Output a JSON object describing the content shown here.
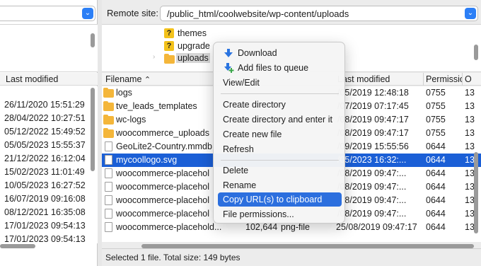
{
  "left": {
    "column_last_modified": "Last modified",
    "dates": [
      "26/11/2020 15:51:29",
      "28/04/2022 10:27:51",
      "05/12/2022 15:49:52",
      "05/05/2023 15:55:37",
      "21/12/2022 16:12:04",
      "15/02/2023 11:01:49",
      "10/05/2023 16:27:52",
      "16/07/2019 09:16:08",
      "08/12/2021 16:35:08",
      "17/01/2023 09:54:13",
      "17/01/2023 09:54:13"
    ]
  },
  "remote": {
    "label": "Remote site:",
    "path": "/public_html/coolwebsite/wp-content/uploads",
    "tree": [
      {
        "label": "themes",
        "icon": "question-folder-icon"
      },
      {
        "label": "upgrade",
        "icon": "question-folder-icon"
      },
      {
        "label": "uploads",
        "icon": "folder-icon"
      }
    ]
  },
  "columns": {
    "filename": "Filename",
    "last_modified": "Last modified",
    "permissions": "Permissio",
    "owner": "O"
  },
  "files": [
    {
      "name": "logs",
      "icon": "folder-icon",
      "size": "",
      "type": "",
      "modified": "/05/2019 12:48:18",
      "perm": "0755",
      "owner": "13"
    },
    {
      "name": "tve_leads_templates",
      "icon": "folder-icon",
      "size": "",
      "type": "",
      "modified": "/07/2019 07:17:45",
      "perm": "0755",
      "owner": "13"
    },
    {
      "name": "wc-logs",
      "icon": "folder-icon",
      "size": "",
      "type": "",
      "modified": "/08/2019 09:47:17",
      "perm": "0755",
      "owner": "13"
    },
    {
      "name": "woocommerce_uploads",
      "icon": "folder-icon",
      "size": "",
      "type": "",
      "modified": "/08/2019 09:47:17",
      "perm": "0755",
      "owner": "13"
    },
    {
      "name": "GeoLite2-Country.mmdb",
      "icon": "file-icon",
      "size": "",
      "type": "",
      "modified": "/09/2019 15:55:56",
      "perm": "0644",
      "owner": "13"
    },
    {
      "name": "mycoollogo.svg",
      "icon": "file-icon",
      "size": "",
      "type": "",
      "modified": "/05/2023 16:32:...",
      "perm": "0644",
      "owner": "13",
      "selected": true
    },
    {
      "name": "woocommerce-placehol",
      "icon": "file-icon",
      "size": "",
      "type": "",
      "modified": "/08/2019 09:47:...",
      "perm": "0644",
      "owner": "13"
    },
    {
      "name": "woocommerce-placehol",
      "icon": "file-icon",
      "size": "",
      "type": "",
      "modified": "/08/2019 09:47:...",
      "perm": "0644",
      "owner": "13"
    },
    {
      "name": "woocommerce-placehol",
      "icon": "file-icon",
      "size": "",
      "type": "",
      "modified": "/08/2019 09:47:...",
      "perm": "0644",
      "owner": "13"
    },
    {
      "name": "woocommerce-placehol",
      "icon": "file-icon",
      "size": "",
      "type": "",
      "modified": "/08/2019 09:47:...",
      "perm": "0644",
      "owner": "13"
    },
    {
      "name": "woocommerce-placehold...",
      "icon": "file-icon",
      "size": "102,644",
      "type": "png-file",
      "modified": "25/08/2019 09:47:17",
      "perm": "0644",
      "owner": "13"
    }
  ],
  "status": "Selected 1 file. Total size: 149 bytes",
  "context_menu": {
    "items": [
      "Download",
      "Add files to queue",
      "View/Edit",
      "Create directory",
      "Create directory and enter it",
      "Create new file",
      "Refresh",
      "Delete",
      "Rename",
      "Copy URL(s) to clipboard",
      "File permissions..."
    ],
    "highlighted": "Copy URL(s) to clipboard"
  },
  "colors": {
    "selection": "#1b5fd6",
    "menu_highlight": "#2c6fde",
    "folder": "#f4b63a",
    "combo_button": "#2c7ff6"
  }
}
